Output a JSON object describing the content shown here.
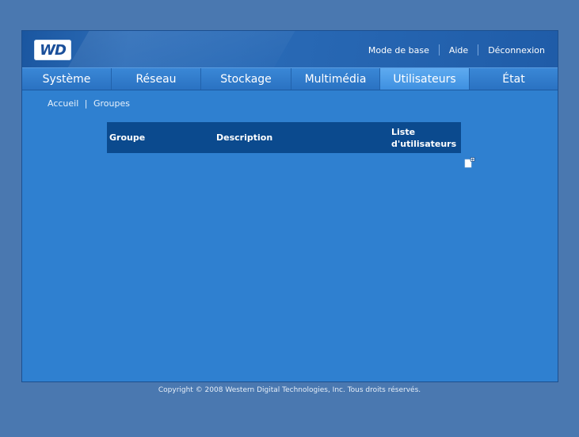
{
  "header": {
    "logo_text": "WD",
    "links": {
      "basic_mode": "Mode de base",
      "help": "Aide",
      "logout": "Déconnexion"
    }
  },
  "nav": {
    "tabs": [
      {
        "label": "Système"
      },
      {
        "label": "Réseau"
      },
      {
        "label": "Stockage"
      },
      {
        "label": "Multimédia"
      },
      {
        "label": "Utilisateurs",
        "active": true
      },
      {
        "label": "État"
      }
    ]
  },
  "breadcrumb": {
    "home": "Accueil",
    "separator": "|",
    "current": "Groupes"
  },
  "table": {
    "columns": [
      "Groupe",
      "Description",
      "Liste d'utilisateurs"
    ],
    "rows": []
  },
  "actions": {
    "add_group_icon": "add-document-icon"
  },
  "footer": {
    "copyright": "Copyright © 2008 Western Digital Technologies, Inc. Tous droits réservés."
  },
  "colors": {
    "page_bg": "#4a78b0",
    "panel_bg": "#2f80d0",
    "header_bg": "#1a56a0",
    "table_header_bg": "#0b4a8e",
    "active_tab_bg": "#5eaaf0"
  }
}
